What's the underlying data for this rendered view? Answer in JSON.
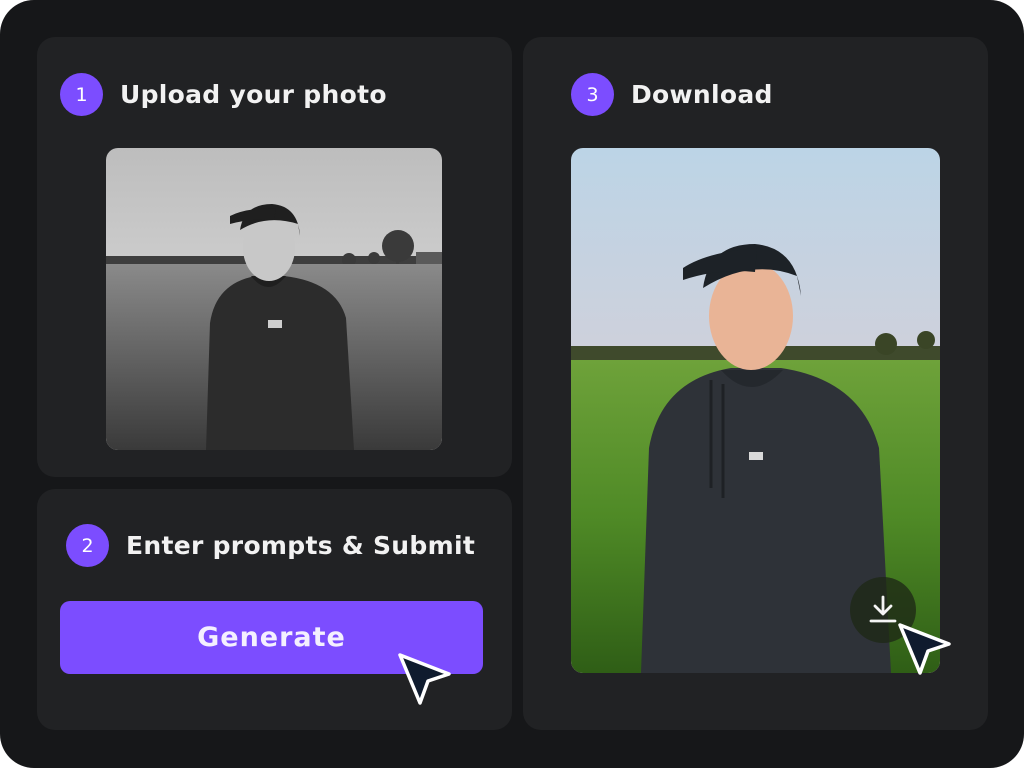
{
  "steps": {
    "upload": {
      "number": "1",
      "title": "Upload your photo",
      "image_alt": "Black and white photo of a man in a cap and hoodie standing in a field"
    },
    "prompt": {
      "number": "2",
      "title": "Enter prompts & Submit",
      "button_label": "Generate"
    },
    "download": {
      "number": "3",
      "title": "Download",
      "image_alt": "Colorized photo of a man in a cap and hoodie standing in a green field"
    }
  },
  "icons": {
    "cursor": "arrow-cursor-icon",
    "download": "download-icon"
  },
  "colors": {
    "accent": "#7c4dff",
    "background": "#161719",
    "card": "#212224",
    "text": "#f2f2f2"
  }
}
